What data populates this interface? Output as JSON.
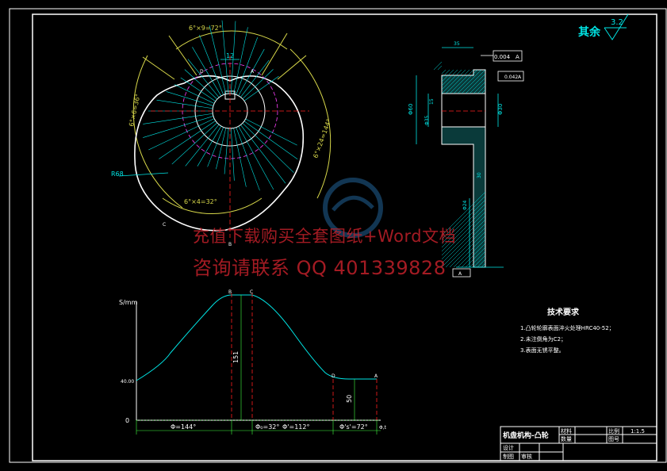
{
  "roughness": {
    "label": "其余",
    "value": "3.2"
  },
  "cam": {
    "top_angle": "6°×9=72°",
    "bottom_angle": "6°×4=32°",
    "left_angle": "6°×6=36°",
    "right_angle": "6°×24=144°",
    "dim_center": "12",
    "dim_r": "R68",
    "points": {
      "a": "A",
      "b": "B",
      "c": "C",
      "d": "D"
    }
  },
  "section": {
    "top_dim": "35",
    "tol_flat": "0.004",
    "tol_flat_ref": "A",
    "tol_perp": "0.042",
    "tol_perp_ref": "A",
    "dim_left": "Φ60",
    "dim_right": "Φ30",
    "dim_mid": "15",
    "dim_small": "Φ35",
    "dim_bottom": "Φ24",
    "dim_low": "30",
    "base_ref": "A"
  },
  "motion": {
    "ylabel": "S/mm",
    "y_low": "0",
    "y_mid": "40.00",
    "dim_151": "151",
    "dim_50": "50",
    "seg1": "Φ=144°",
    "seg2": "Φ₀=32°",
    "seg3": "Φ'=112°",
    "seg4": "Φ's'=72°",
    "axis_end": "Φ,t",
    "pts": {
      "a": "A",
      "b": "B",
      "c": "C",
      "d": "D"
    }
  },
  "tech": {
    "title": "技术要求",
    "items": [
      "1.凸轮轮廓表面淬火处理HRC40-52；",
      "2.未注倒角为C2；",
      "3.表面无锈平整。"
    ]
  },
  "title_block": {
    "name": "机盘机构-凸轮",
    "material_label": "材料",
    "qty_label": "数量",
    "scale_label": "比例",
    "scale_value": "1:1.5",
    "drawing_no_label": "图号",
    "design_label": "设计",
    "draw_label": "制图",
    "review_label": "审核"
  },
  "watermark": {
    "line1": "充值下载购买全套图纸+Word文档",
    "line2": "咨询请联系  QQ 401339828"
  },
  "colors": {
    "cyan": "#00e5e5",
    "yellow": "#d8d84a",
    "white": "#ffffff",
    "red": "#ff2020",
    "magenta": "#ff40ff",
    "green": "#40ff40"
  }
}
